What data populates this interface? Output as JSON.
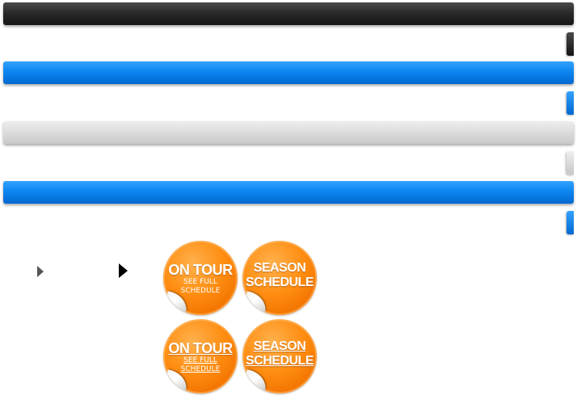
{
  "bars": [
    {
      "style": "dark",
      "color": "#2b2b2b"
    },
    {
      "style": "blue",
      "color": "#0d86f1"
    },
    {
      "style": "light",
      "color": "#dcdcdc"
    },
    {
      "style": "blue",
      "color": "#0d86f1"
    }
  ],
  "arrows": [
    {
      "icon": "play-arrow-icon",
      "color": "#555555"
    },
    {
      "icon": "play-arrow-icon",
      "color": "#000000"
    }
  ],
  "badges": {
    "tour_title": "ON TOUR",
    "tour_sub_1": "SEE FULL",
    "tour_sub_2": "SCHEDULE",
    "season_1": "SEASON",
    "season_2": "SCHEDULE",
    "color": "#ff8e12"
  }
}
